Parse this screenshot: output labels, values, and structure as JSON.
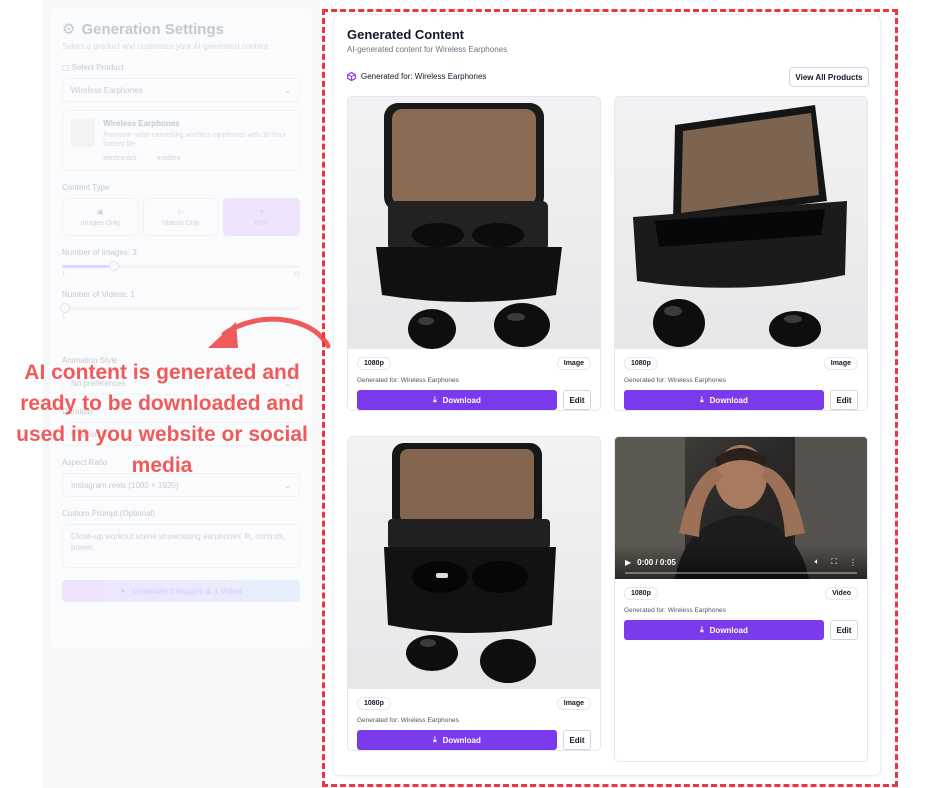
{
  "settings": {
    "title": "Generation Settings",
    "subtitle": "Select a product and customize your AI-generated content",
    "select_product_label": "Select Product",
    "selected_product": "Wireless Earphones",
    "product_card": {
      "name": "Wireless Earphones",
      "description": "Premium noise-cancelling wireless earphones with 30-hour battery life",
      "tags": [
        "electronics",
        "modern"
      ]
    },
    "content_type_label": "Content Type",
    "content_types": [
      "Images Only",
      "Videos Only",
      "Both"
    ],
    "num_images_label": "Number of Images: 3",
    "num_images_min": "1",
    "num_images_max": "10",
    "num_images_level": 0.22,
    "num_videos_label": "Number of Videos: 1",
    "num_videos_min": "1",
    "num_videos_level": 0.0,
    "animation_style_label": "Animation Style",
    "animation_style_value": "No preferences",
    "duration_label": "Duration",
    "duration_value": "6 seconds",
    "aspect_ratio_label": "Aspect Ratio",
    "aspect_ratio_value": "Instagram reels (1080 × 1920)",
    "custom_prompt_label": "Custom Prompt (Optional)",
    "custom_prompt_value": "Close-up workout scene showcasing earphones' fit, controls, power.",
    "generate_button": "Generate 3 Images & 1 Video"
  },
  "annotation": {
    "text": "AI content is generated and ready to be downloaded and used in you website or social media",
    "color": "#f05a5a"
  },
  "content": {
    "title": "Generated Content",
    "subtitle": "AI-generated content for Wireless Earphones",
    "generated_for": "Generated for: Wireless Earphones",
    "view_all_label": "View All Products",
    "accent": "#7c3aed",
    "items": [
      {
        "resolution": "1080p",
        "type": "Image",
        "caption": "Generated for: Wireless Earphones",
        "download_label": "Download",
        "edit_label": "Edit"
      },
      {
        "resolution": "1080p",
        "type": "Image",
        "caption": "Generated for: Wireless Earphones",
        "download_label": "Download",
        "edit_label": "Edit"
      },
      {
        "resolution": "1080p",
        "type": "Image",
        "caption": "Generated for: Wireless Earphones",
        "download_label": "Download",
        "edit_label": "Edit"
      },
      {
        "resolution": "1080p",
        "type": "Video",
        "caption": "Generated for: Wireless Earphones",
        "download_label": "Download",
        "edit_label": "Edit",
        "video_time": "0:00 / 0:05"
      }
    ]
  }
}
